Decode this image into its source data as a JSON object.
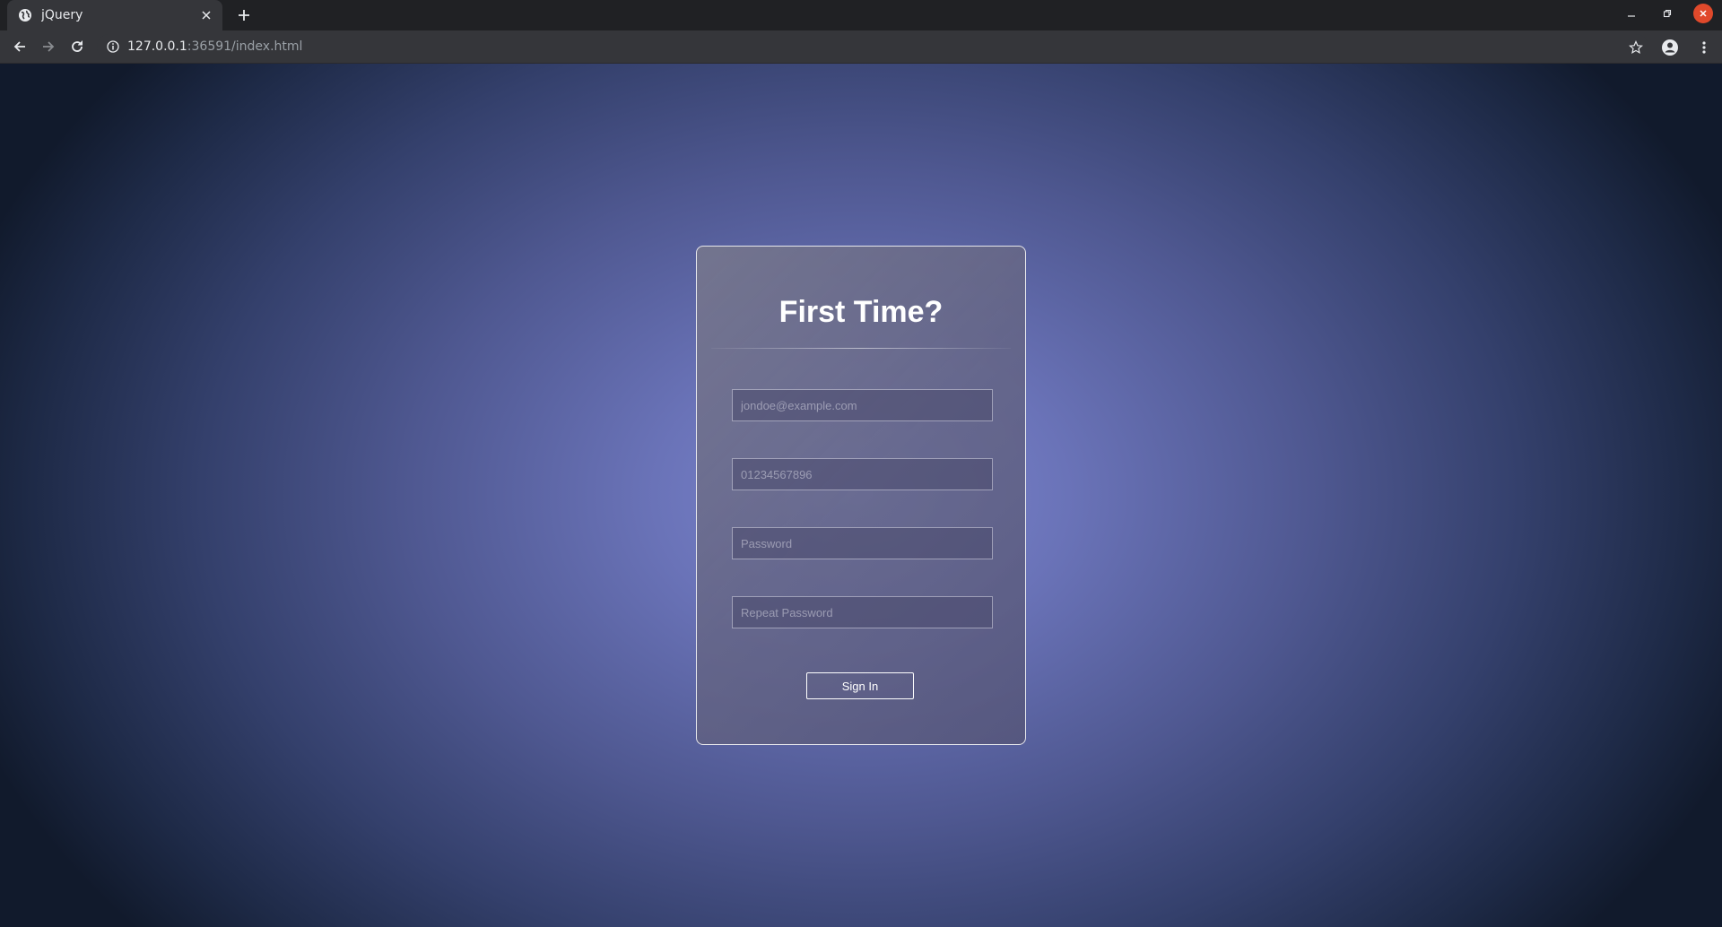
{
  "browser": {
    "tab_title": "jQuery",
    "url_host": "127.0.0.1",
    "url_rest": ":36591/index.html"
  },
  "form": {
    "title": "First Time?",
    "email_placeholder": "jondoe@example.com",
    "phone_placeholder": "01234567896",
    "password_placeholder": "Password",
    "repeat_password_placeholder": "Repeat Password",
    "submit_label": "Sign In"
  },
  "icons": {
    "favicon": "globe-icon",
    "tab_close": "close-icon",
    "new_tab": "plus-icon",
    "back": "arrow-left-icon",
    "forward": "arrow-right-icon",
    "reload": "reload-icon",
    "site_info": "info-icon",
    "bookmark": "star-icon",
    "profile": "account-icon",
    "menu": "kebab-menu-icon"
  },
  "colors": {
    "browser_frame": "#202124",
    "toolbar": "#35363a",
    "window_close": "#e0492b",
    "background_center": "#7d87d0",
    "background_edge": "#111a2c"
  }
}
